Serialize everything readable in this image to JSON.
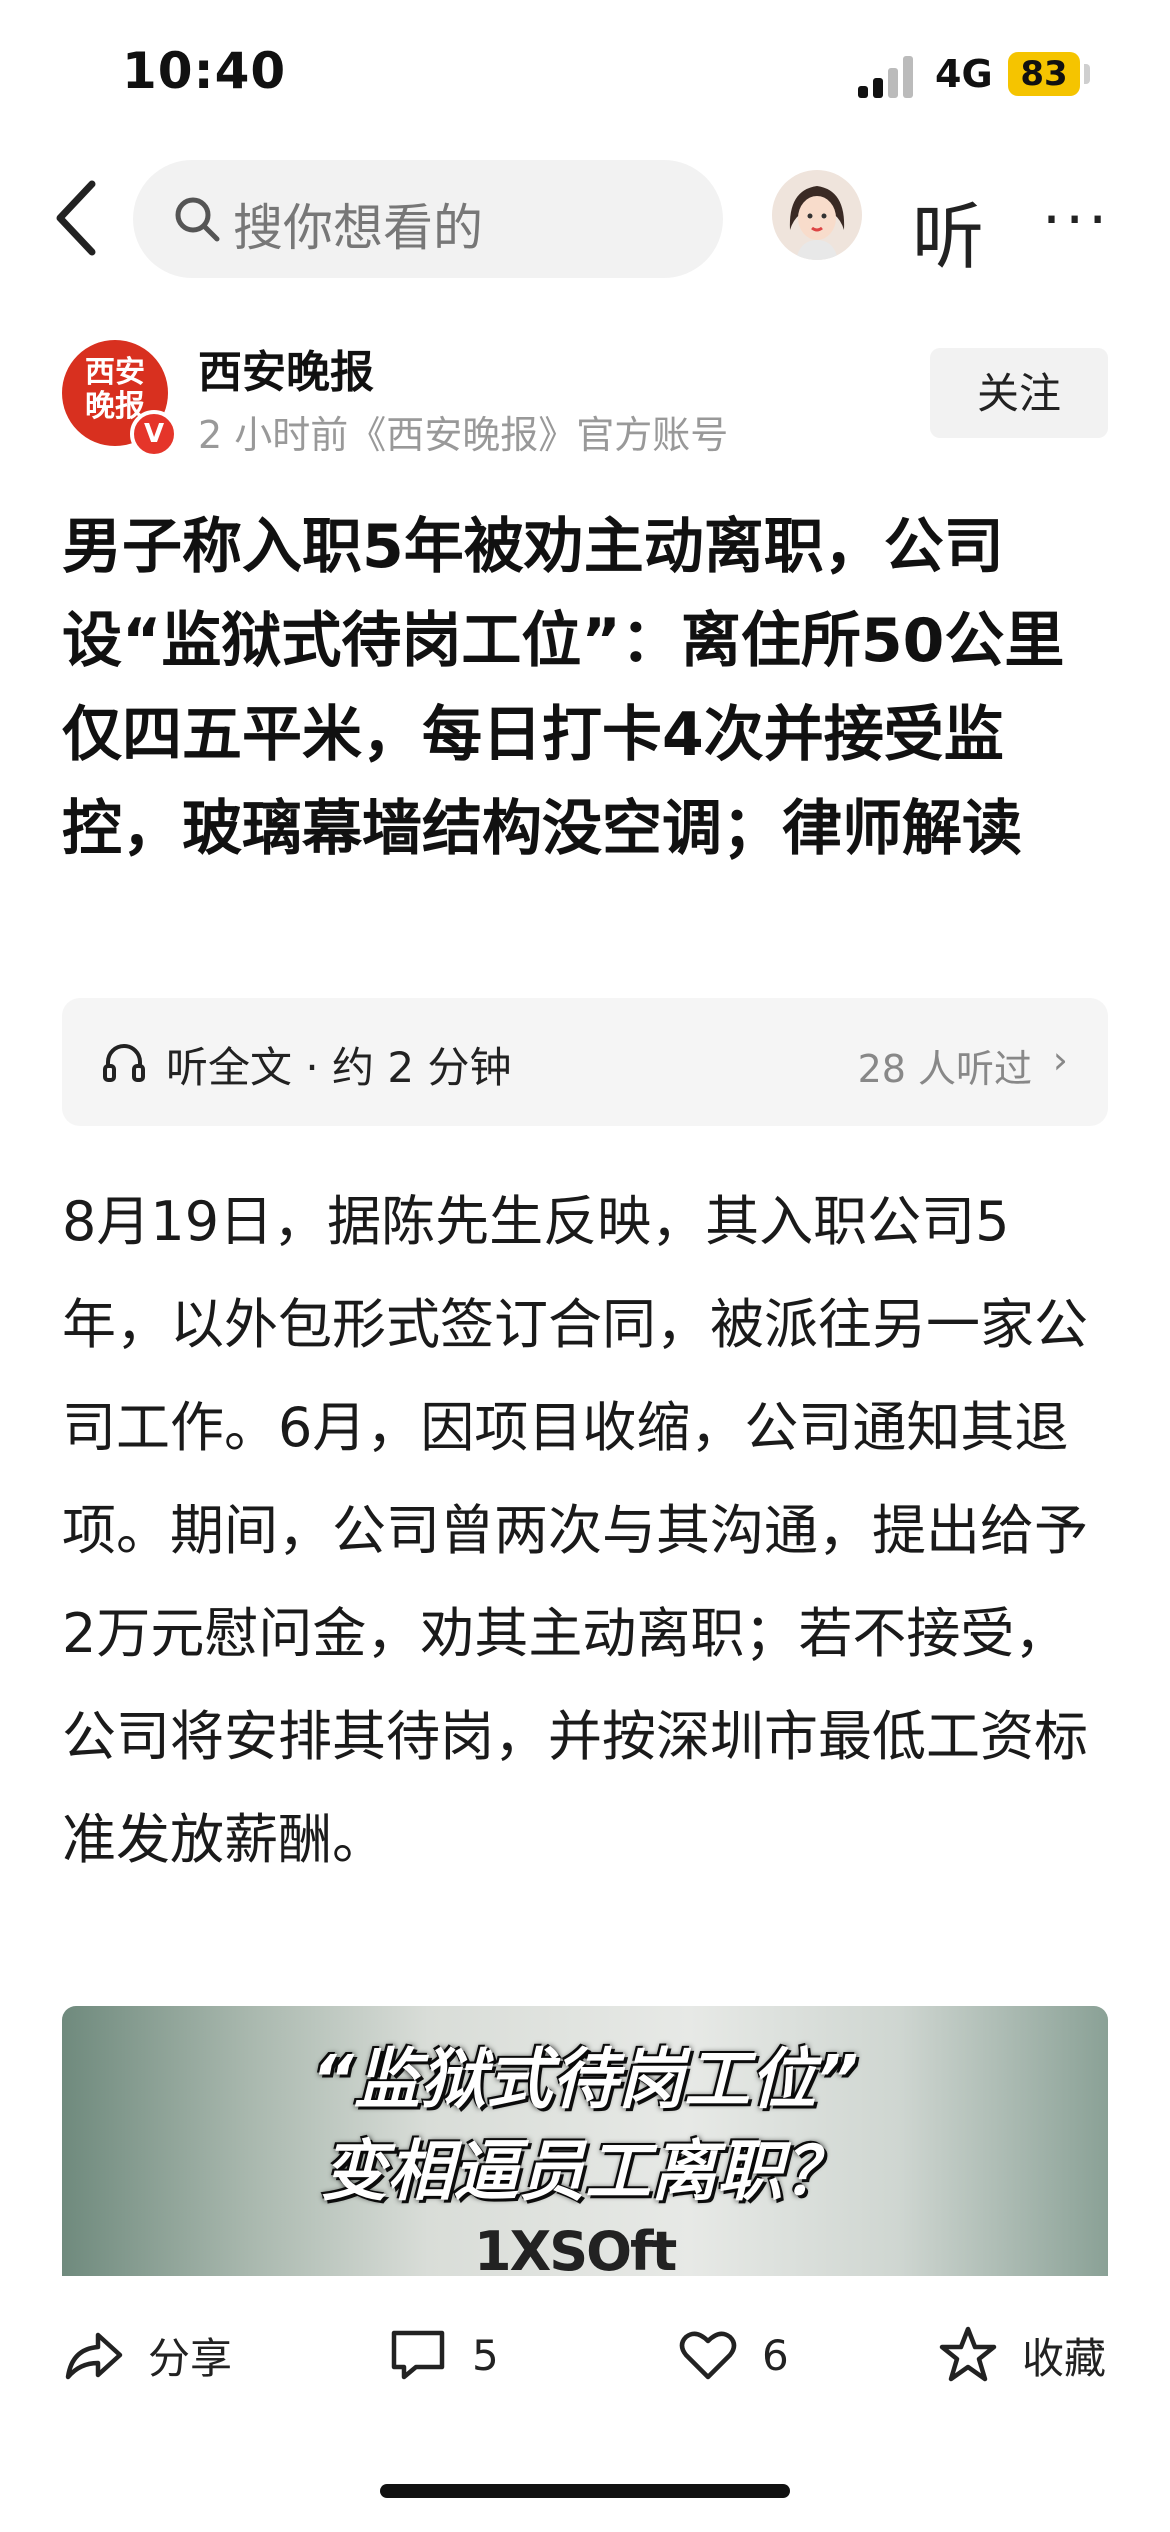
{
  "status_bar": {
    "time": "10:40",
    "network": "4G",
    "battery": "83"
  },
  "nav": {
    "search_placeholder": "搜你想看的",
    "listen_label": "听",
    "more_label": "···"
  },
  "author": {
    "name": "西安晚报",
    "meta": "2 小时前《西安晚报》官方账号",
    "logo_text_1": "西安",
    "logo_text_2": "晚报",
    "verified_mark": "V",
    "follow_label": "关注"
  },
  "article": {
    "title": "男子称入职5年被劝主动离职，公司设“监狱式待岗工位”：离住所50公里仅四五平米，每日打卡4次并接受监控，玻璃幕墙结构没空调；律师解读",
    "listen_label": "听全文 · 约 2 分钟",
    "listen_count": "28 人听过",
    "listen_chevron": "›",
    "body": "8月19日，据陈先生反映，其入职公司5年，以外包形式签订合同，被派往另一家公司工作。6月，因项目收缩，公司通知其退项。期间，公司曾两次与其沟通，提出给予2万元慰问金，劝其主动离职；若不接受，公司将安排其待岗，并按深圳市最低工资标准发放薪酬。",
    "image": {
      "line1": "“监狱式待岗工位”",
      "line2": "变相逼员工离职？",
      "logo": "1XSOft"
    }
  },
  "bottom_bar": {
    "share_label": "分享",
    "comment_count": "5",
    "like_count": "6",
    "collect_label": "收藏"
  }
}
